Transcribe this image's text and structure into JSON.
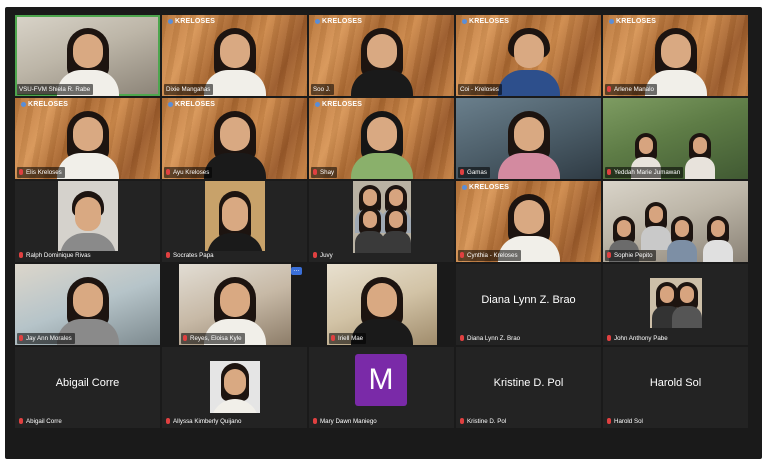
{
  "brand_text": "KRELOSES",
  "colors": {
    "background": "#1a1a1a",
    "active_speaker": "#4ea64e",
    "muted_mic": "#e04040",
    "avatar_m": "#7a2aa8",
    "more_button": "#3a6fd8"
  },
  "participants": [
    {
      "name": "VSU-FVM Shiela R. Rabe",
      "muted": false
    },
    {
      "name": "Dixie Mangahas",
      "muted": false
    },
    {
      "name": "Soo J.",
      "muted": false
    },
    {
      "name": "Coi - Kreloses",
      "muted": false
    },
    {
      "name": "Arlene Manalo",
      "muted": true
    },
    {
      "name": "Elis Kreloses",
      "muted": true
    },
    {
      "name": "Ayu Kreloses",
      "muted": true
    },
    {
      "name": "Shay",
      "muted": true
    },
    {
      "name": "Gamas",
      "muted": true
    },
    {
      "name": "Yeddah Marie Jumawan",
      "muted": true
    },
    {
      "name": "Ralph Dominique Rivas",
      "muted": true
    },
    {
      "name": "Socrates Papa",
      "muted": true
    },
    {
      "name": "Juvy",
      "muted": true
    },
    {
      "name": "Cynthia - Kreloses",
      "muted": true
    },
    {
      "name": "Sophie Pepito",
      "muted": true
    },
    {
      "name": "Jay Ann Morales",
      "muted": true
    },
    {
      "name": "Reyes, Eloisa Kyle",
      "muted": true
    },
    {
      "name": "Iriell Mae",
      "muted": true
    },
    {
      "name": "Diana Lynn Z. Brao",
      "muted": true,
      "big_name": "Diana Lynn Z. Brao"
    },
    {
      "name": "John Anthony Pabe",
      "muted": true
    },
    {
      "name": "Abigail Corre",
      "muted": true,
      "big_name": "Abigail Corre"
    },
    {
      "name": "Allyssa Kimberly Quijano",
      "muted": true
    },
    {
      "name": "Mary Dawn Maniego",
      "muted": true,
      "avatar_letter": "M"
    },
    {
      "name": "Kristine D. Pol",
      "muted": true,
      "big_name": "Kristine D. Pol"
    },
    {
      "name": "Harold Sol",
      "muted": true,
      "big_name": "Harold Sol"
    }
  ]
}
